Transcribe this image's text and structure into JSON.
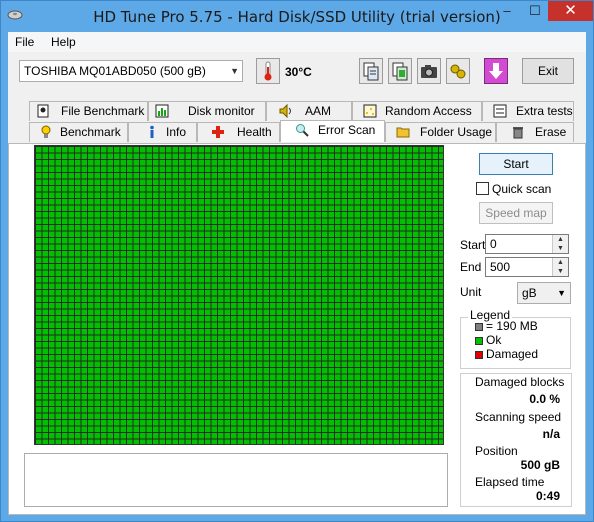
{
  "window": {
    "title": "HD Tune Pro 5.75 - Hard Disk/SSD Utility (trial version)",
    "minimize_glyph": "–",
    "maximize_glyph": "☐",
    "close_glyph": "✕"
  },
  "menu": {
    "file_label": "File",
    "help_label": "Help"
  },
  "toolbar": {
    "drive": "TOSHIBA MQ01ABD050 (500 gB)",
    "temperature": "30°C",
    "exit_label": "Exit"
  },
  "tabs": {
    "top": [
      {
        "label": "File Benchmark",
        "icon": "file-benchmark-icon"
      },
      {
        "label": "Disk monitor",
        "icon": "disk-monitor-icon"
      },
      {
        "label": "AAM",
        "icon": "speaker-icon"
      },
      {
        "label": "Random Access",
        "icon": "random-access-icon"
      },
      {
        "label": "Extra tests",
        "icon": "extra-tests-icon"
      }
    ],
    "bottom": [
      {
        "label": "Benchmark",
        "icon": "lightbulb-icon"
      },
      {
        "label": "Info",
        "icon": "info-icon"
      },
      {
        "label": "Health",
        "icon": "health-cross-icon"
      },
      {
        "label": "Error Scan",
        "icon": "magnifier-icon"
      },
      {
        "label": "Folder Usage",
        "icon": "folder-icon"
      },
      {
        "label": "Erase",
        "icon": "trash-icon"
      }
    ],
    "active": "Error Scan"
  },
  "controls": {
    "start_label": "Start",
    "quick_scan_label": "Quick scan",
    "quick_scan_checked": false,
    "speed_map_label": "Speed map",
    "start_field_label": "Start",
    "start_value": "0",
    "end_field_label": "End",
    "end_value": "500",
    "unit_label": "Unit",
    "unit_value": "gB"
  },
  "legend": {
    "title": "Legend",
    "items": [
      {
        "label": "= 190 MB",
        "color": "#808080"
      },
      {
        "label": "Ok",
        "color": "#00c000"
      },
      {
        "label": "Damaged",
        "color": "#e00000"
      }
    ]
  },
  "stats": {
    "damaged_label": "Damaged blocks",
    "damaged_value": "0.0 %",
    "speed_label": "Scanning speed",
    "speed_value": "n/a",
    "position_label": "Position",
    "position_value": "500 gB",
    "elapsed_label": "Elapsed time",
    "elapsed_value": "0:49"
  },
  "colors": {
    "titlebar": "#5da9e8",
    "ok_block": "#00c000",
    "close_button": "#c7312c"
  }
}
